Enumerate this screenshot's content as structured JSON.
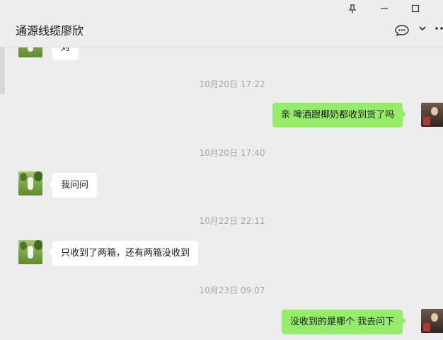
{
  "window": {
    "title": "通源线缆廖欣",
    "controls": {
      "pin_icon": "pin-icon",
      "minimize_icon": "minimize-icon",
      "maximize_icon": "maximize-icon"
    },
    "header_icons": [
      "chat-bubble-icon",
      "chevron-down-icon",
      "more-icon"
    ]
  },
  "messages": [
    {
      "type": "text",
      "side": "left",
      "text": "对"
    },
    {
      "type": "time",
      "text": "10月20日 17:22"
    },
    {
      "type": "text",
      "side": "right",
      "text": "亲 啤酒跟椰奶都收到货了吗"
    },
    {
      "type": "time",
      "text": "10月20日 17:40"
    },
    {
      "type": "text",
      "side": "left",
      "text": "我问问"
    },
    {
      "type": "time",
      "text": "10月22日 22:11"
    },
    {
      "type": "text",
      "side": "left",
      "text": "只收到了两箱，还有两箱没收到"
    },
    {
      "type": "time",
      "text": "10月23日 09:07"
    },
    {
      "type": "text",
      "side": "right",
      "text": "没收到的是哪个 我去问下"
    }
  ],
  "colors": {
    "background": "#ededed",
    "self_bubble": "#95ec69",
    "other_bubble": "#ffffff",
    "timestamp": "#a6a6a6"
  }
}
